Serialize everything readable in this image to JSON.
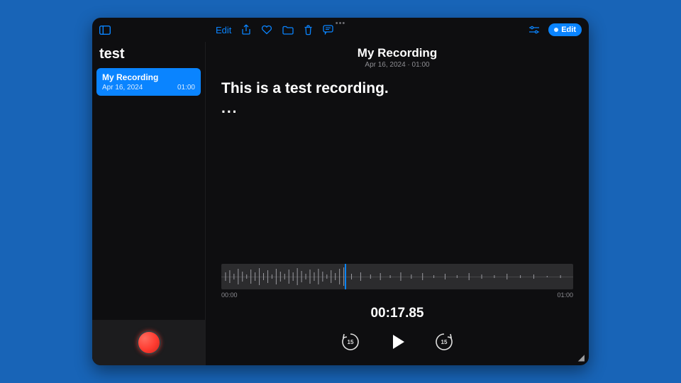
{
  "colors": {
    "accent": "#0a84ff",
    "record": "#ff3b30"
  },
  "toolbar": {
    "edit_left_label": "Edit",
    "edit_right_label": "Edit"
  },
  "sidebar": {
    "title": "test",
    "items": [
      {
        "title": "My Recording",
        "date": "Apr 16, 2024",
        "duration": "01:00"
      }
    ]
  },
  "main": {
    "title": "My Recording",
    "subtitle": "Apr 16, 2024 · 01:00",
    "transcript_line": "This is a test recording.",
    "transcript_continuation": "..."
  },
  "waveform": {
    "start_label": "00:00",
    "end_label": "01:00",
    "current_time": "00:17.85",
    "playhead_percent": 35
  },
  "controls": {
    "skip_seconds": "15"
  }
}
